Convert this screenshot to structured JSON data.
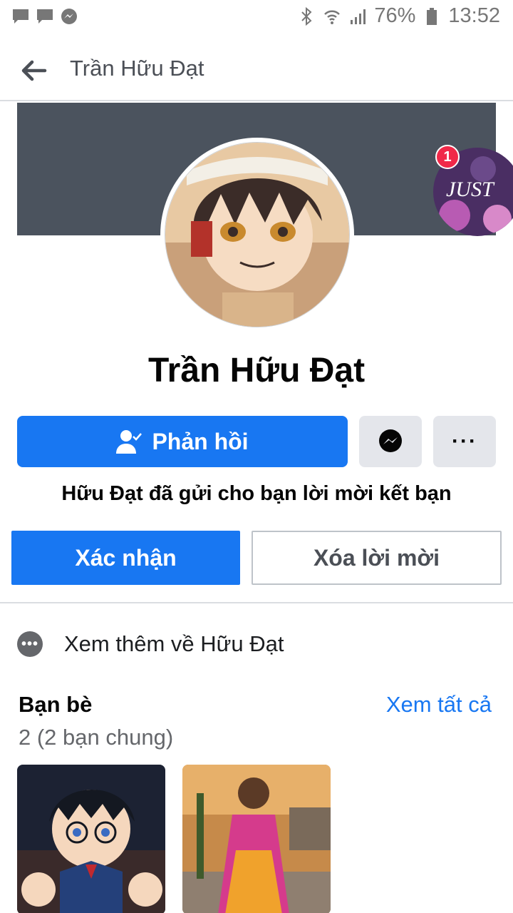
{
  "status_bar": {
    "battery": "76%",
    "time": "13:52"
  },
  "header": {
    "title": "Trần Hữu Đạt"
  },
  "profile": {
    "name": "Trần Hữu Đạt",
    "avatar_alt": "anime-boy-avatar",
    "notification_count": "1",
    "floating_avatar_text": "JUST"
  },
  "actions": {
    "respond_label": "Phản hồi",
    "more_label": "···"
  },
  "friend_request": {
    "message": "Hữu Đạt đã gửi cho bạn lời mời kết bạn",
    "confirm_label": "Xác nhận",
    "delete_label": "Xóa lời mời"
  },
  "see_more": {
    "label": "Xem thêm về Hữu Đạt"
  },
  "friends": {
    "title": "Bạn bè",
    "see_all": "Xem tất cả",
    "count": "2 (2 bạn chung)"
  },
  "colors": {
    "brand_blue": "#1877f2",
    "cover": "#4b535e",
    "badge_red": "#f02849"
  }
}
